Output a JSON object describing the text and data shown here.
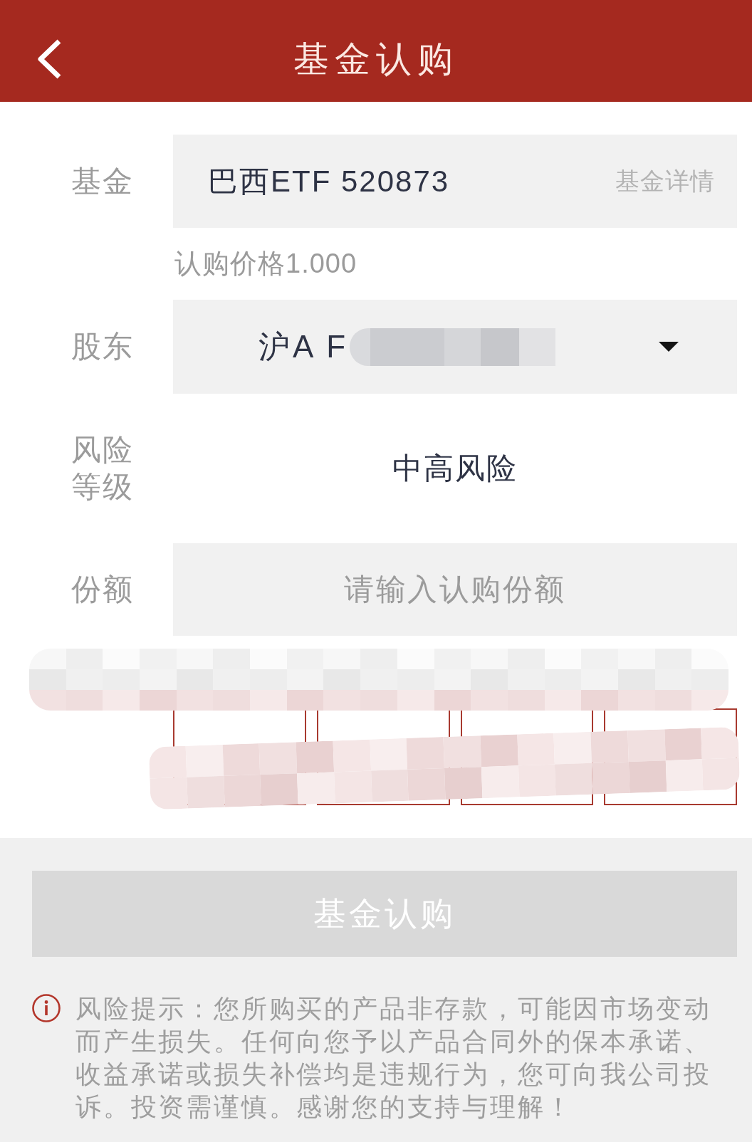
{
  "header": {
    "title": "基金认购"
  },
  "rows": [
    {
      "kind": "display",
      "label": "基金",
      "value": "巴西ETF 520873",
      "link": "基金详情"
    },
    {
      "kind": "note",
      "text": "认购价格1.000"
    },
    {
      "kind": "select",
      "label": "股东",
      "value": "沪A F",
      "redacted": true
    },
    {
      "kind": "static",
      "label": "风险等级",
      "value": "中高风险"
    },
    {
      "kind": "input",
      "label": "份额",
      "placeholder": "请输入认购份额"
    },
    {
      "kind": "shortcuts",
      "mosaic": true,
      "buttons": [
        {
          "kind": "outline"
        },
        {
          "kind": "outline"
        },
        {
          "kind": "outline"
        },
        {
          "kind": "outline"
        }
      ]
    }
  ],
  "submit_button": {
    "label": "基金认购",
    "disabled": true
  },
  "risk_notice": {
    "text": "风险提示：您所购买的产品非存款，可能因市场变动而产生损失。任何向您予以产品合同外的保本承诺、收益承诺或损失补偿均是违规行为，您可向我公司投诉。投资需谨慎。感谢您的支持与理解！"
  }
}
